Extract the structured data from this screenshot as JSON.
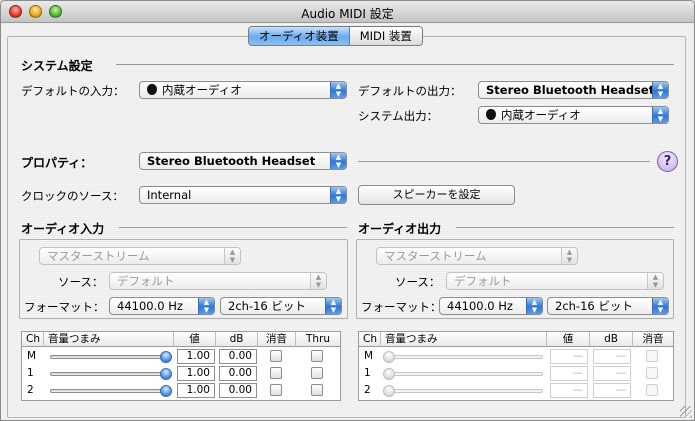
{
  "window": {
    "title": "Audio MIDI 設定"
  },
  "tabs": [
    {
      "label": "オーディオ装置",
      "selected": true
    },
    {
      "label": "MIDI 装置",
      "selected": false
    }
  ],
  "system": {
    "heading": "システム設定",
    "default_input_label": "デフォルトの入力：",
    "default_input_value": "内蔵オーディオ",
    "default_output_label": "デフォルトの出力：",
    "default_output_value": "Stereo Bluetooth Headset",
    "system_output_label": "システム出力：",
    "system_output_value": "内蔵オーディオ"
  },
  "properties": {
    "label": "プロパティ：",
    "device_value": "Stereo Bluetooth Headset",
    "help_label": "?",
    "clock_label": "クロックのソース：",
    "clock_value": "Internal",
    "speaker_button": "スピーカーを設定"
  },
  "audio_input": {
    "heading": "オーディオ入力",
    "stream_value": "マスターストリーム",
    "source_label": "ソース：",
    "source_value": "デフォルト",
    "format_label": "フォーマット：",
    "rate_value": "44100.0 Hz",
    "bits_value": "2ch-16 ビット",
    "columns": [
      "Ch",
      "音量つまみ",
      "値",
      "dB",
      "消音",
      "Thru"
    ],
    "rows": [
      {
        "ch": "M",
        "level": 1.0,
        "value": "1.00",
        "db": "0.00"
      },
      {
        "ch": "1",
        "level": 1.0,
        "value": "1.00",
        "db": "0.00"
      },
      {
        "ch": "2",
        "level": 1.0,
        "value": "1.00",
        "db": "0.00"
      }
    ]
  },
  "audio_output": {
    "heading": "オーディオ出力",
    "stream_value": "マスターストリーム",
    "source_label": "ソース：",
    "source_value": "デフォルト",
    "format_label": "フォーマット：",
    "rate_value": "44100.0 Hz",
    "bits_value": "2ch-16 ビット",
    "columns": [
      "Ch",
      "音量つまみ",
      "値",
      "dB",
      "消音"
    ],
    "rows": [
      {
        "ch": "M",
        "level": 0.0,
        "value": "—",
        "db": "—"
      },
      {
        "ch": "1",
        "level": 0.0,
        "value": "—",
        "db": "—"
      },
      {
        "ch": "2",
        "level": 0.0,
        "value": "—",
        "db": "—"
      }
    ]
  }
}
